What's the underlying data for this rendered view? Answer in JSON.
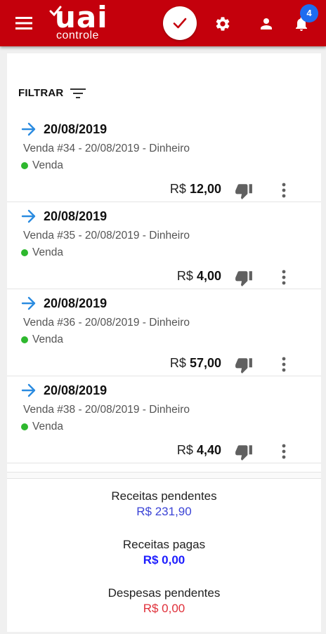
{
  "app": {
    "logo_main": "uai",
    "logo_sub": "controle",
    "notification_count": "4",
    "brand_color": "#c4000c"
  },
  "filter": {
    "label": "FILTRAR"
  },
  "items": [
    {
      "date": "20/08/2019",
      "description": "Venda #34 - 20/08/2019 - Dinheiro",
      "type": "Venda",
      "currency": "R$",
      "value": "12,00"
    },
    {
      "date": "20/08/2019",
      "description": "Venda #35 - 20/08/2019 - Dinheiro",
      "type": "Venda",
      "currency": "R$",
      "value": "4,00"
    },
    {
      "date": "20/08/2019",
      "description": "Venda #36 - 20/08/2019 - Dinheiro",
      "type": "Venda",
      "currency": "R$",
      "value": "57,00"
    },
    {
      "date": "20/08/2019",
      "description": "Venda #38 - 20/08/2019 - Dinheiro",
      "type": "Venda",
      "currency": "R$",
      "value": "4,40"
    }
  ],
  "summary": {
    "receitas_pendentes_label": "Receitas pendentes",
    "receitas_pendentes_value": "R$ 231,90",
    "receitas_pagas_label": "Receitas pagas",
    "receitas_pagas_value": "R$ 0,00",
    "despesas_pendentes_label": "Despesas pendentes",
    "despesas_pendentes_value": "R$ 0,00"
  }
}
